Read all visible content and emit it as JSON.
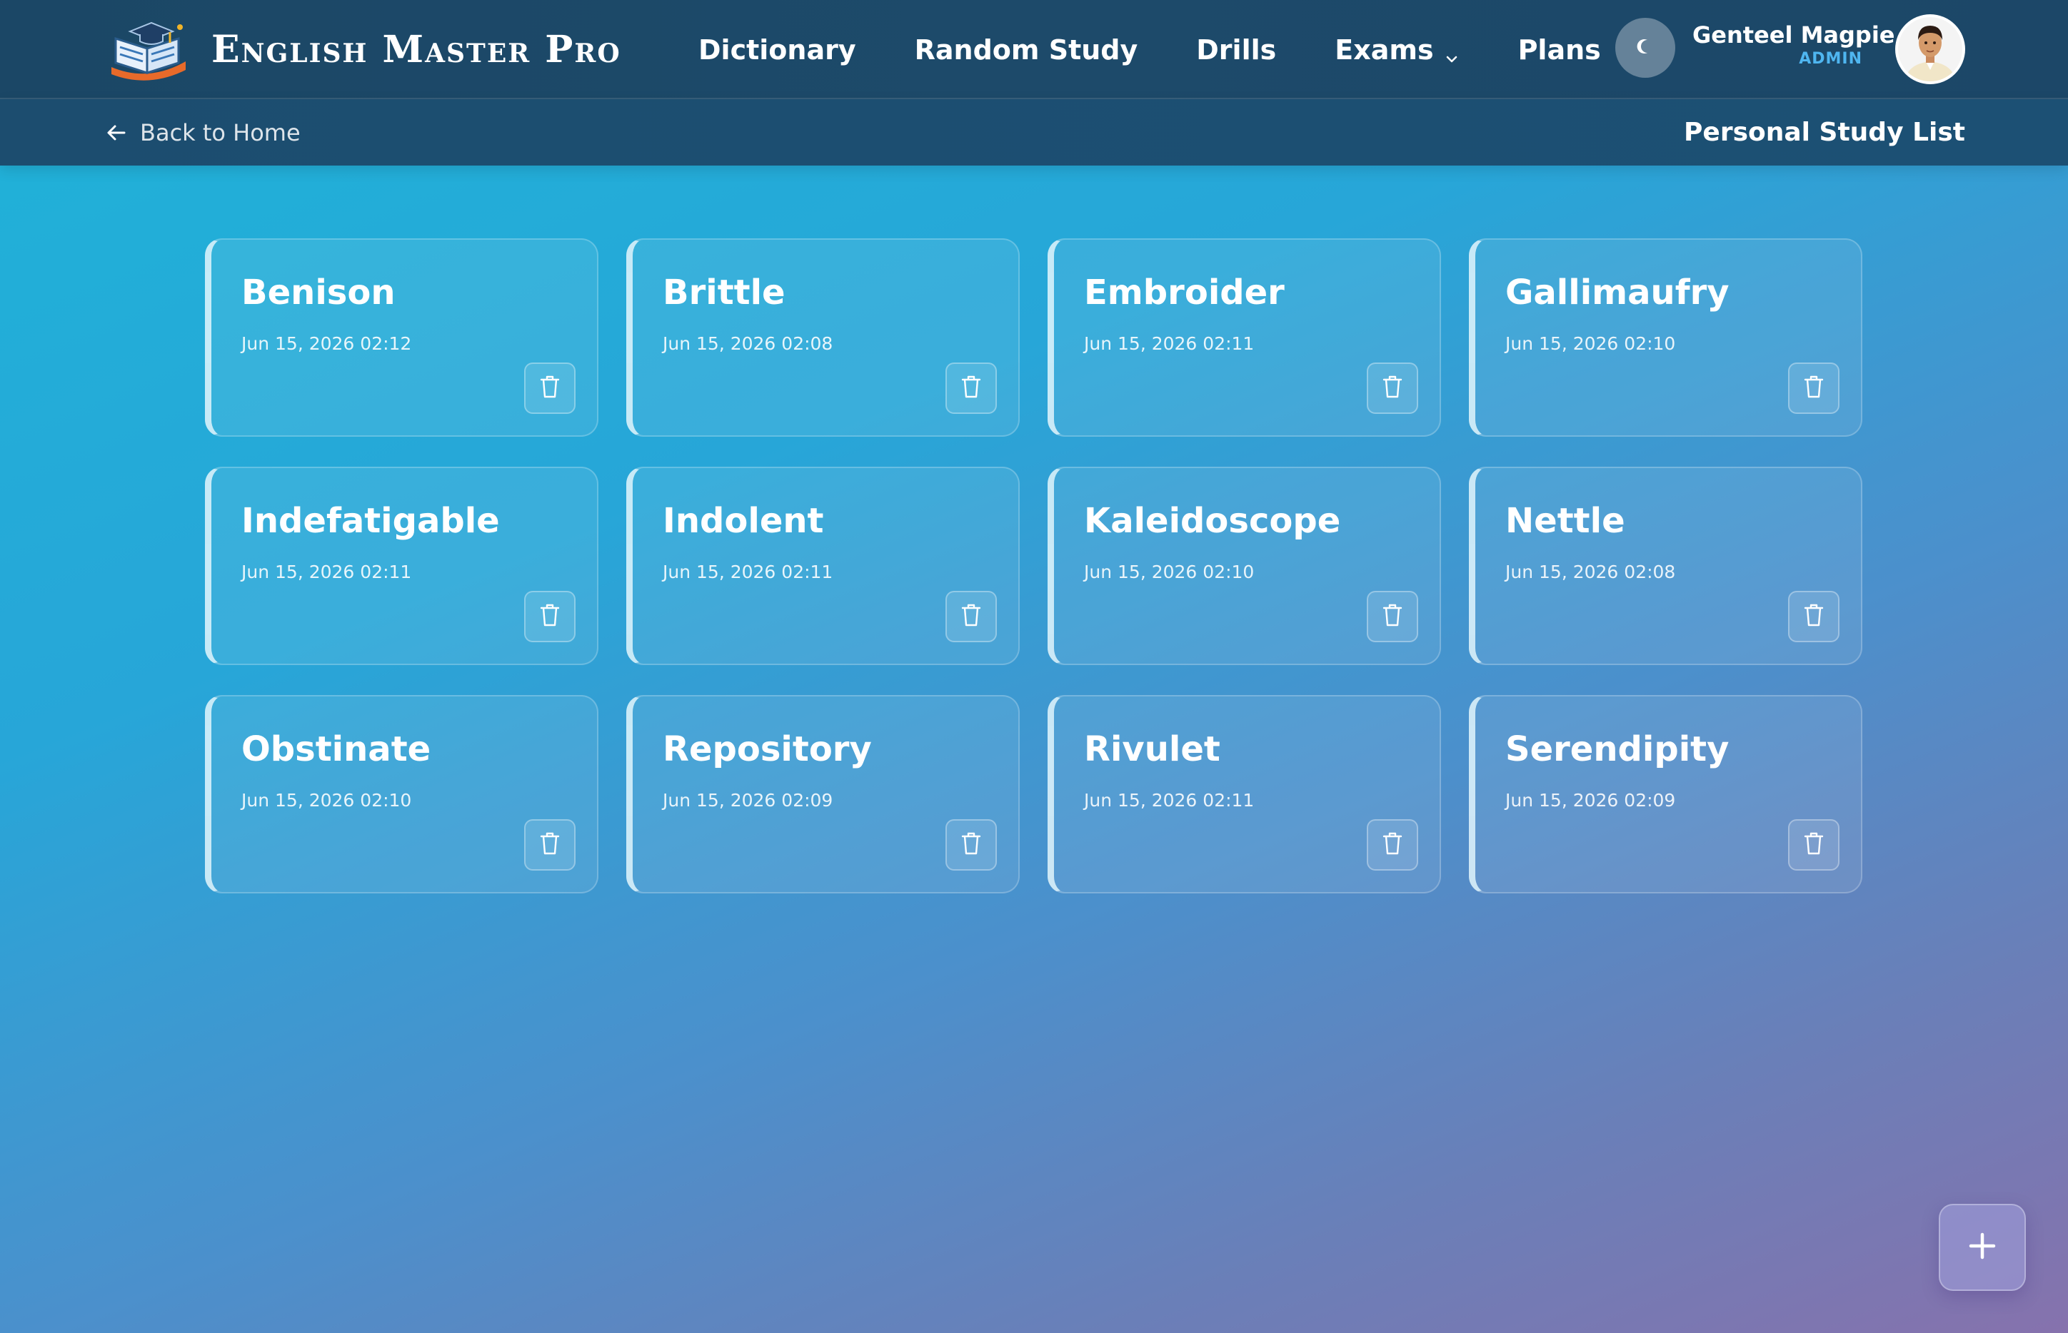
{
  "header": {
    "brand_name": "English Master Pro",
    "logo_icon": "book-graduation-cap-icon",
    "nav": [
      {
        "label": "Dictionary"
      },
      {
        "label": "Random Study"
      },
      {
        "label": "Drills"
      },
      {
        "label": "Exams",
        "has_dropdown": true
      },
      {
        "label": "Plans"
      }
    ],
    "theme_toggle_icon": "moon-icon",
    "user": {
      "name": "Genteel Magpie",
      "role": "ADMIN"
    }
  },
  "subbar": {
    "back_label": "Back to Home",
    "page_title": "Personal Study List"
  },
  "words": [
    {
      "word": "Benison",
      "date": "Jun 15, 2026 02:12"
    },
    {
      "word": "Brittle",
      "date": "Jun 15, 2026 02:08"
    },
    {
      "word": "Embroider",
      "date": "Jun 15, 2026 02:11"
    },
    {
      "word": "Gallimaufry",
      "date": "Jun 15, 2026 02:10"
    },
    {
      "word": "Indefatigable",
      "date": "Jun 15, 2026 02:11"
    },
    {
      "word": "Indolent",
      "date": "Jun 15, 2026 02:11"
    },
    {
      "word": "Kaleidoscope",
      "date": "Jun 15, 2026 02:10"
    },
    {
      "word": "Nettle",
      "date": "Jun 15, 2026 02:08"
    },
    {
      "word": "Obstinate",
      "date": "Jun 15, 2026 02:10"
    },
    {
      "word": "Repository",
      "date": "Jun 15, 2026 02:09"
    },
    {
      "word": "Rivulet",
      "date": "Jun 15, 2026 02:11"
    },
    {
      "word": "Serendipity",
      "date": "Jun 15, 2026 02:09"
    }
  ],
  "fab_icon": "plus-icon",
  "colors": {
    "accent": "#4fb6f0",
    "header_bg": "#1b4766"
  }
}
